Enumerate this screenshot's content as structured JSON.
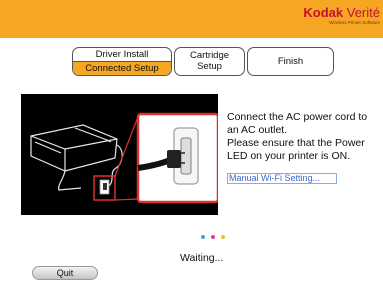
{
  "brand": {
    "name": "Kodak",
    "product": "Verité",
    "tagline": "Wireless Printer Software"
  },
  "steps": {
    "driver_install": "Driver Install",
    "connected_setup": "Connected Setup",
    "cartridge_line1": "Cartridge",
    "cartridge_line2": "Setup",
    "finish": "Finish"
  },
  "instructions": {
    "line1": "Connect the AC power cord to",
    "line2": "an AC outlet.",
    "line3": "Please ensure that the Power",
    "line4": "LED on your printer is ON."
  },
  "manual_link": "Manual Wi-Fi Setting...",
  "status": {
    "waiting": "Waiting..."
  },
  "buttons": {
    "quit": "Quit"
  },
  "colors": {
    "accent": "#f5a623",
    "brand_red": "#c8102e",
    "dot_blue": "#3aa3e3",
    "dot_pink": "#e23d8c",
    "dot_yellow": "#f0c419"
  },
  "icons": {
    "progress": "loading-dots-icon"
  }
}
